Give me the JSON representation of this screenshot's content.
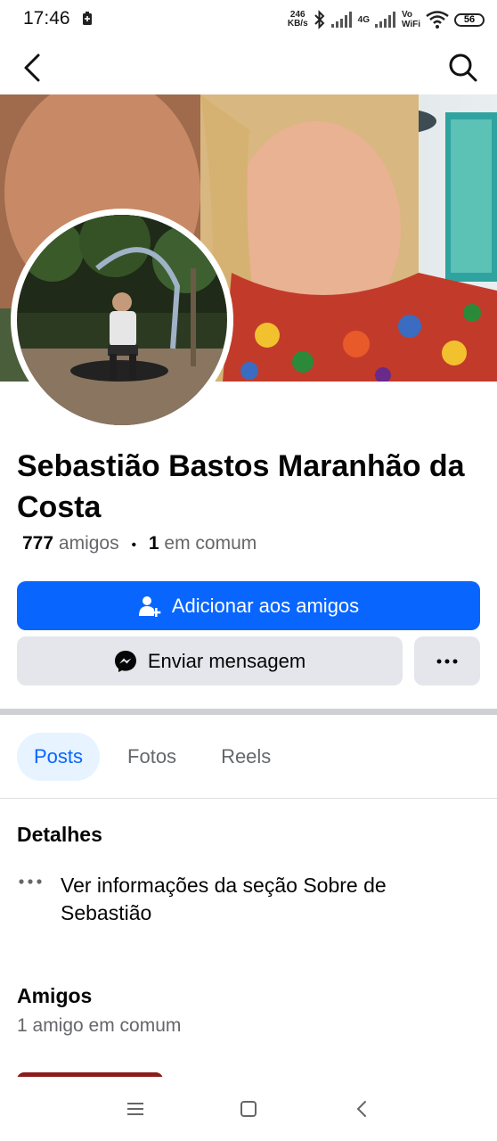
{
  "status_bar": {
    "time": "17:46",
    "speed_value": "246",
    "speed_unit": "KB/s",
    "network": "4G",
    "vo": "Vo",
    "wifi": "WiFi",
    "battery": "56"
  },
  "profile": {
    "name": "Sebastião Bastos Maranhão da Costa",
    "friends_count": "777",
    "friends_word": "amigos",
    "separator": "•",
    "mutual_count": "1",
    "mutual_word": "em comum"
  },
  "actions": {
    "add_friend_label": "Adicionar aos amigos",
    "message_label": "Enviar mensagem"
  },
  "tabs": [
    {
      "label": "Posts",
      "active": true
    },
    {
      "label": "Fotos",
      "active": false
    },
    {
      "label": "Reels",
      "active": false
    }
  ],
  "details": {
    "title": "Detalhes",
    "about_link": "Ver informações da seção Sobre de Sebastião"
  },
  "friends_section": {
    "title": "Amigos",
    "mutual_text": "1 amigo em comum"
  },
  "colors": {
    "primary": "#0866ff",
    "secondary_button": "#e4e6eb",
    "muted_text": "#65676b"
  },
  "icons": [
    "back-arrow-icon",
    "search-icon",
    "add-friend-icon",
    "messenger-icon",
    "more-icon",
    "menu-icon",
    "home-icon",
    "back-nav-icon"
  ]
}
